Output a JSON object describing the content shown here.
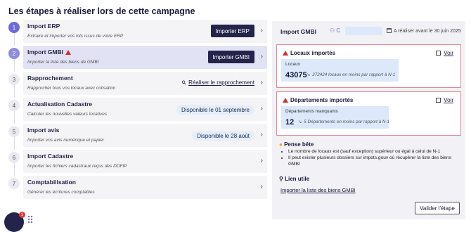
{
  "page": {
    "title": "Les étapes à réaliser lors de cette campagne"
  },
  "steps": [
    {
      "number": "1",
      "title": "Import ERP",
      "subtitle": "Extraire et importer vos lots issus de votre ERP",
      "action": "Importer ERP"
    },
    {
      "number": "2",
      "title": "Import GMBI",
      "subtitle": "Importer la liste des biens de GMBI",
      "action": "Importer GMBI"
    },
    {
      "number": "3",
      "title": "Rapprochement",
      "subtitle": "Rapprocher tous vos locaux avec cotisation",
      "action": "Réaliser le rapprochement"
    },
    {
      "number": "4",
      "title": "Actualisation Cadastre",
      "subtitle": "Calculer les nouvelles valeurs locatives",
      "action": "Disponible le 01 septembre"
    },
    {
      "number": "5",
      "title": "Import avis",
      "subtitle": "Importer vos avis numérique et papier",
      "action": "Disponible le 28 août"
    },
    {
      "number": "6",
      "title": "Import Cadastre",
      "subtitle": "Importer les fichiers cadastraux reçus des DDFIP"
    },
    {
      "number": "7",
      "title": "Comptabilisation",
      "subtitle": "Générer les écritures comptables"
    }
  ],
  "panel": {
    "title": "Import GMBI",
    "assignee_initial": "C",
    "due": "A réaliser avant le 30 juin 2025",
    "locaux": {
      "title": "Locaux importés",
      "link": "Voir",
      "label": "Locaux",
      "value": "43075",
      "comparison": "272424 locaux en moins par rapport à N-1"
    },
    "departements": {
      "title": "Départements importés",
      "link": "Voir",
      "label": "Départements manquants",
      "value": "12",
      "comparison": "5 Départements en moins par rapport à N-1"
    },
    "pense_bete": {
      "title": "Pense bête",
      "items": [
        "Le nombre de locaux est (sauf exception) supérieur ou égal à celui de N-1",
        "Il peut exister plusieurs dossiers sur impots.gouv où récupérer la liste des biens GMBI"
      ]
    },
    "lien_utile": {
      "title": "Lien utile",
      "link": "Importer la liste des biens GMBI"
    },
    "validate": "Valider l'étape"
  },
  "chat": {
    "badge": "1"
  },
  "colors": {
    "primary_dark": "#24244a",
    "accent": "#6a6ad8",
    "warning": "#d32f2f",
    "stat_bg": "#dbe9fb"
  }
}
